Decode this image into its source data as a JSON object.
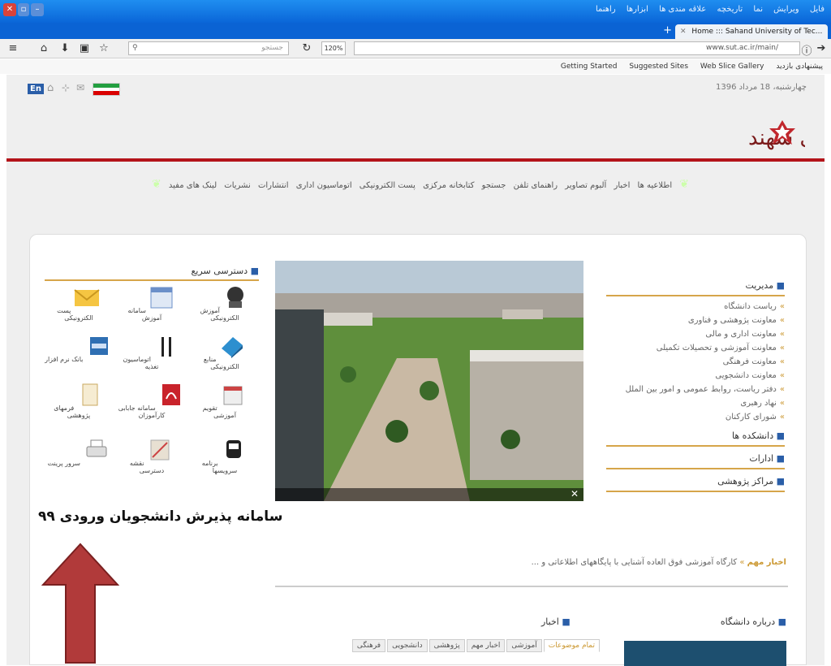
{
  "browser": {
    "menu": [
      "راهنما",
      "ابزارها",
      "علاقه مندی ها",
      "تاریخچه",
      "نما",
      "ویرایش",
      "فایل"
    ],
    "tab_title": "Home ::: Sahand University of Tec...",
    "search_placeholder": "جستجو",
    "zoom": "120%",
    "url": "www.sut.ac.ir/main/",
    "bookmarks": [
      "پیشنهادی بازدید",
      "Getting Started",
      "Suggested Sites",
      "Web Slice Gallery"
    ]
  },
  "page": {
    "date": "چهارشنبه، 18 مرداد 1396",
    "lang_button": "En",
    "logo_text": "دانشگاه صنعتی سهند",
    "nav": [
      "اطلاعیه ها",
      "اخبار",
      "آلبوم تصاویر",
      "راهنمای تلفن",
      "جستجو",
      "کتابخانه مرکزی",
      "پست الکترونیکی",
      "اتوماسیون اداری",
      "انتشارات",
      "نشریات",
      "لینک های مفید"
    ],
    "quick_access": {
      "title": "دسترسی سریع",
      "items": [
        {
          "label": "آموزش الکترونیکی",
          "icon": "e-learning-icon"
        },
        {
          "label": "سامانه آموزش",
          "icon": "calendar-icon"
        },
        {
          "label": "پست الکترونیکی",
          "icon": "email-icon"
        },
        {
          "label": "منابع الکترونیکی",
          "icon": "book-icon"
        },
        {
          "label": "اتوماسیون تغذیه",
          "icon": "fork-knife-icon"
        },
        {
          "label": "بانک نرم افزار",
          "icon": "ftp-icon"
        },
        {
          "label": "تقویم آموزشی",
          "icon": "calendar-page-icon"
        },
        {
          "label": "سامانه جابابی کارآموزان",
          "icon": "pdf-icon"
        },
        {
          "label": "فرمهای پژوهشی",
          "icon": "document-icon"
        },
        {
          "label": "برنامه سرویسها",
          "icon": "bus-icon"
        },
        {
          "label": "نقشه دسترسی",
          "icon": "map-icon"
        },
        {
          "label": "سرور پرینت",
          "icon": "printer-icon"
        }
      ]
    },
    "management": {
      "title": "مدیریت",
      "items": [
        "ریاست دانشگاه",
        "معاونت پژوهشی و فناوری",
        "معاونت اداری و مالی",
        "معاونت آموزشی و تحصیلات تکمیلی",
        "معاونت فرهنگی",
        "معاونت دانشجویی",
        "دفتر ریاست، روابط عمومی و امور بین الملل",
        "نهاد رهبری",
        "شورای کارکنان"
      ]
    },
    "sections": [
      "دانشکده ها",
      "ادارات",
      "مراکز پژوهشی"
    ],
    "banner_text": "سامانه پذیرش دانشجویان ورودی ۹۹",
    "important_news": {
      "label": "اخبار مهم",
      "text": "کارگاه آموزشی فوق العاده آشنایی با پایگاههای اطلاعاتی و ..."
    },
    "about_title": "درباره دانشگاه",
    "news_title": "اخبار",
    "news_tabs": [
      "تمام موضوعات",
      "آموزشی",
      "اخبار مهم",
      "پژوهشی",
      "دانشجویی",
      "فرهنگی"
    ],
    "colors": {
      "accent": "#d6a54a",
      "brand_red": "#b4141a",
      "arrow": "#b13a3a"
    }
  }
}
